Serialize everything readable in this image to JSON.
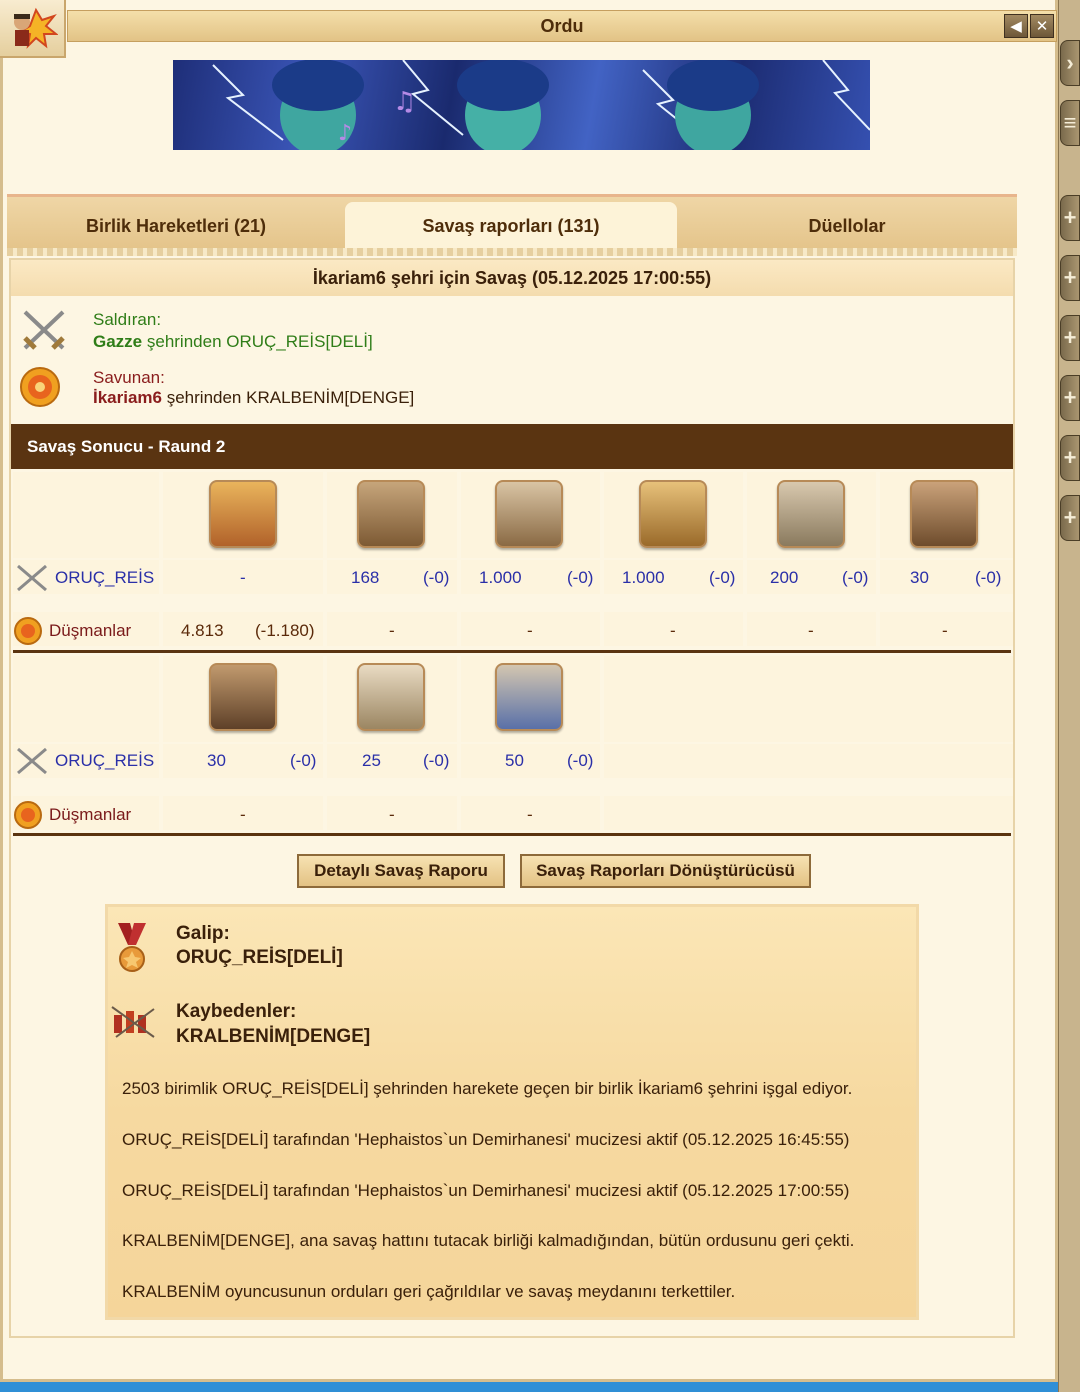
{
  "window": {
    "title": "Ordu"
  },
  "tabs": [
    {
      "label": "Birlik Hareketleri (21)",
      "active": false
    },
    {
      "label": "Savaş raporları (131)",
      "active": true
    },
    {
      "label": "Düellolar",
      "active": false
    }
  ],
  "report": {
    "title": "İkariam6 şehri için Savaş (05.12.2025 17:00:55)",
    "attacker_label": "Saldıran:",
    "attacker_city": "Gazze",
    "attacker_rest": " şehrinden ORUÇ_REİS[DELİ]",
    "defender_label": "Savunan:",
    "defender_city": "İkariam6",
    "defender_rest": " şehrinden KRALBENİM[DENGE]"
  },
  "round": {
    "title": "Savaş Sonucu - Raund 2"
  },
  "rows": {
    "own_name": "ORUÇ_REİS",
    "enemy_name": "Düşmanlar"
  },
  "block1": {
    "own": [
      {
        "v": "-",
        "d": ""
      },
      {
        "v": "168",
        "d": "(-0)"
      },
      {
        "v": "1.000",
        "d": "(-0)"
      },
      {
        "v": "1.000",
        "d": "(-0)"
      },
      {
        "v": "200",
        "d": "(-0)"
      },
      {
        "v": "30",
        "d": "(-0)"
      }
    ],
    "enemy": [
      {
        "v": "4.813",
        "d": "(-1.180)"
      },
      {
        "v": "-",
        "d": ""
      },
      {
        "v": "-",
        "d": ""
      },
      {
        "v": "-",
        "d": ""
      },
      {
        "v": "-",
        "d": ""
      },
      {
        "v": "-",
        "d": ""
      }
    ]
  },
  "block2": {
    "own": [
      {
        "v": "30",
        "d": "(-0)"
      },
      {
        "v": "25",
        "d": "(-0)"
      },
      {
        "v": "50",
        "d": "(-0)"
      }
    ],
    "enemy": [
      {
        "v": "-",
        "d": ""
      },
      {
        "v": "-",
        "d": ""
      },
      {
        "v": "-",
        "d": ""
      }
    ]
  },
  "buttons": {
    "detailed": "Detaylı Savaş Raporu",
    "converter": "Savaş Raporları Dönüştürücüsü"
  },
  "result": {
    "winner_label": "Galip:",
    "winner": "ORUÇ_REİS[DELİ]",
    "loser_label": "Kaybedenler:",
    "loser": "KRALBENİM[DENGE]",
    "messages": [
      "2503 birimlik ORUÇ_REİS[DELİ] şehrinden harekete geçen bir birlik İkariam6 şehrini işgal ediyor.",
      "ORUÇ_REİS[DELİ] tarafından 'Hephaistos`un Demirhanesi' mucizesi aktif (05.12.2025 16:45:55)",
      "ORUÇ_REİS[DELİ] tarafından 'Hephaistos`un Demirhanesi' mucizesi aktif (05.12.2025 17:00:55)",
      "KRALBENİM[DENGE], ana savaş hattını tutacak birliği kalmadığından, bütün ordusunu geri çekti.",
      "KRALBENİM oyuncusunun orduları geri çağrıldılar ve savaş meydanını terkettiler."
    ]
  },
  "colors": {
    "accent_brown": "#5a3411",
    "attacker_green": "#2f7d18",
    "defender_red": "#8a1d1d",
    "own_blue": "#2a2fa8"
  }
}
